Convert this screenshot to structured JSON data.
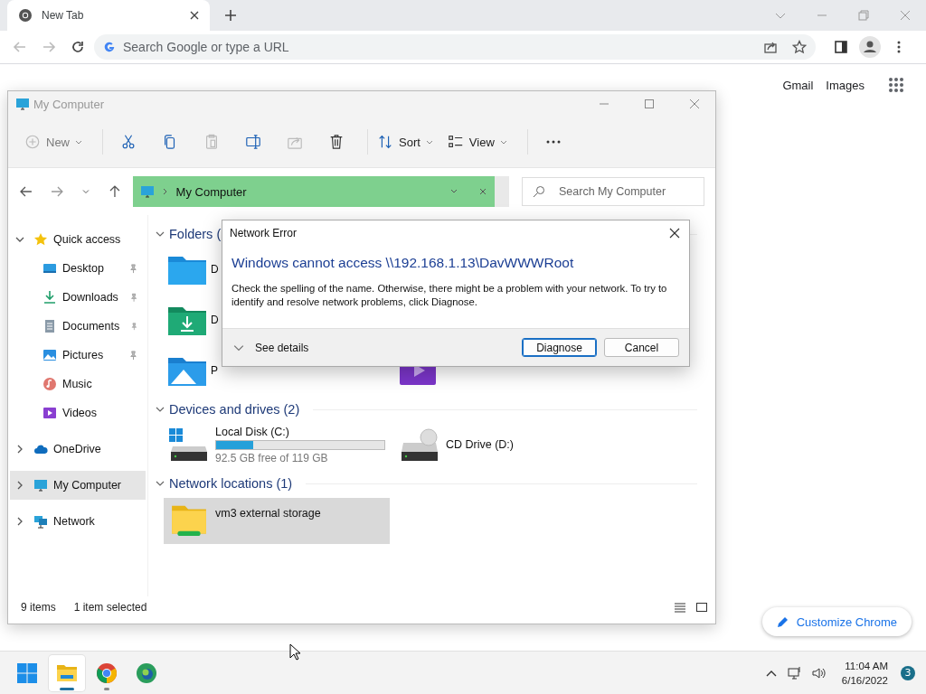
{
  "browser": {
    "tabs": [
      {
        "title": "New Tab",
        "selected": true
      }
    ],
    "address_bar": {
      "placeholder": "Search Google or type a URL"
    },
    "page_links": [
      "Gmail",
      "Images"
    ],
    "customize_button": "Customize Chrome"
  },
  "explorer": {
    "title": "My Computer",
    "toolbar": [
      {
        "kind": "new",
        "label": "New",
        "disabled": true
      },
      {
        "kind": "cut",
        "disabled": false
      },
      {
        "kind": "copy",
        "disabled": false
      },
      {
        "kind": "paste",
        "disabled": true
      },
      {
        "kind": "rename",
        "disabled": false
      },
      {
        "kind": "share",
        "disabled": true
      },
      {
        "kind": "delete",
        "disabled": false
      },
      {
        "kind": "sort",
        "label": "Sort",
        "disabled": false
      },
      {
        "kind": "view",
        "label": "View",
        "disabled": false
      },
      {
        "kind": "more",
        "disabled": false
      }
    ],
    "address": {
      "path": "My Computer"
    },
    "search": {
      "placeholder": "Search My Computer"
    },
    "sidebar": [
      {
        "label": "Quick access",
        "kind": "star",
        "expanded": true,
        "selected": false,
        "children": [
          {
            "label": "Desktop",
            "kind": "desktop",
            "pinned": true,
            "selected": false
          },
          {
            "label": "Downloads",
            "kind": "downloads",
            "pinned": true,
            "selected": false
          },
          {
            "label": "Documents",
            "kind": "documents",
            "pinned": true,
            "selected": false
          },
          {
            "label": "Pictures",
            "kind": "pictures",
            "pinned": true,
            "selected": false
          },
          {
            "label": "Music",
            "kind": "music",
            "pinned": false,
            "selected": false
          },
          {
            "label": "Videos",
            "kind": "videos",
            "pinned": false,
            "selected": false
          }
        ]
      },
      {
        "label": "OneDrive",
        "kind": "cloud",
        "expanded": false,
        "selected": false
      },
      {
        "label": "My Computer",
        "kind": "computer",
        "expanded": false,
        "selected": true
      },
      {
        "label": "Network",
        "kind": "network",
        "expanded": false,
        "selected": false
      }
    ],
    "sections": [
      {
        "title": "Folders (",
        "kind": "folders",
        "items": [
          {
            "label": "D",
            "kind": "desktop",
            "selected": false
          },
          {
            "label": "D",
            "kind": "downloads",
            "selected": false
          },
          {
            "label": "P",
            "kind": "pictures",
            "selected": false
          },
          {
            "kind": "videos",
            "selected": false
          }
        ]
      },
      {
        "title": "Devices and drives (2)",
        "kind": "drives",
        "items": [
          {
            "label": "Local Disk (C:)",
            "kind": "disk",
            "level": 0.22,
            "free": "92.5 GB free of 119 GB",
            "selected": false
          },
          {
            "label": "CD Drive (D:)",
            "kind": "cd",
            "selected": false
          }
        ]
      },
      {
        "title": "Network locations (1)",
        "kind": "network",
        "items": [
          {
            "label": "vm3 external storage",
            "kind": "netfolder",
            "selected": true
          }
        ]
      }
    ],
    "status": {
      "item_count": "9 items",
      "selection": "1 item selected"
    }
  },
  "dialog": {
    "title": "Network Error",
    "heading": "Windows cannot access \\\\192.168.1.13\\DavWWWRoot",
    "message": "Check the spelling of the name. Otherwise, there might be a problem with your network. To try to identify and resolve network problems, click Diagnose.",
    "details_label": "See details",
    "buttons": [
      {
        "label": "Diagnose",
        "default": true
      },
      {
        "label": "Cancel",
        "default": false
      }
    ]
  },
  "taskbar": {
    "apps": [
      {
        "kind": "start",
        "running": false,
        "selected": false
      },
      {
        "kind": "explorer",
        "running": true,
        "selected": true
      },
      {
        "kind": "chrome",
        "running": true,
        "selected": false
      },
      {
        "kind": "edge",
        "running": false,
        "selected": false
      }
    ],
    "time": "11:04 AM",
    "date": "6/16/2022",
    "notifications": "3"
  }
}
